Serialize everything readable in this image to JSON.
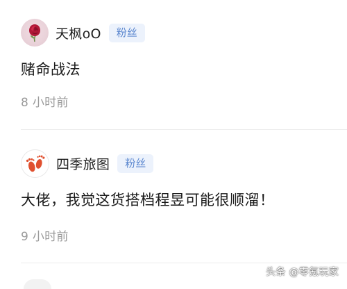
{
  "comments": [
    {
      "username": "天枫oO",
      "badge": "粉丝",
      "text": "赌命战法",
      "time": "8 小时前",
      "avatar_icon": "rose-avatar-icon"
    },
    {
      "username": "四季旅图",
      "badge": "粉丝",
      "text": "大佬，我觉这货搭档程昱可能很顺溜！",
      "time": "9 小时前",
      "avatar_icon": "footprints-avatar-icon"
    }
  ],
  "watermark": "头条 @零氪玩家",
  "colors": {
    "badge_bg": "#ecf2fc",
    "badge_text": "#5b87cf",
    "time_text": "#9a9a9a",
    "divider": "#ececec"
  }
}
